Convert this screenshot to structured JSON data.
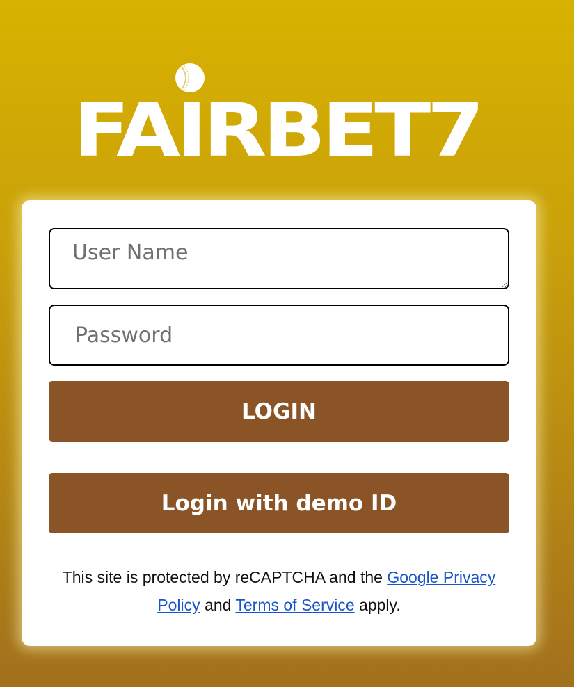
{
  "brand": {
    "logo_text": "FAIRBET7",
    "logo_icon": "cricket-ball-icon",
    "colors": {
      "background_top": "#d8b200",
      "background_bottom": "#a2701d",
      "button": "#8b5426",
      "link": "#1a55c9"
    }
  },
  "login_form": {
    "username_placeholder": "User Name",
    "password_placeholder": "Password",
    "login_label": "LOGIN",
    "demo_label": "Login with demo ID"
  },
  "notice": {
    "prefix": "This site is protected by reCAPTCHA and the",
    "privacy_link": "Google Privacy Policy",
    "middle": "and",
    "terms_link": "Terms of Service",
    "suffix": "apply."
  }
}
